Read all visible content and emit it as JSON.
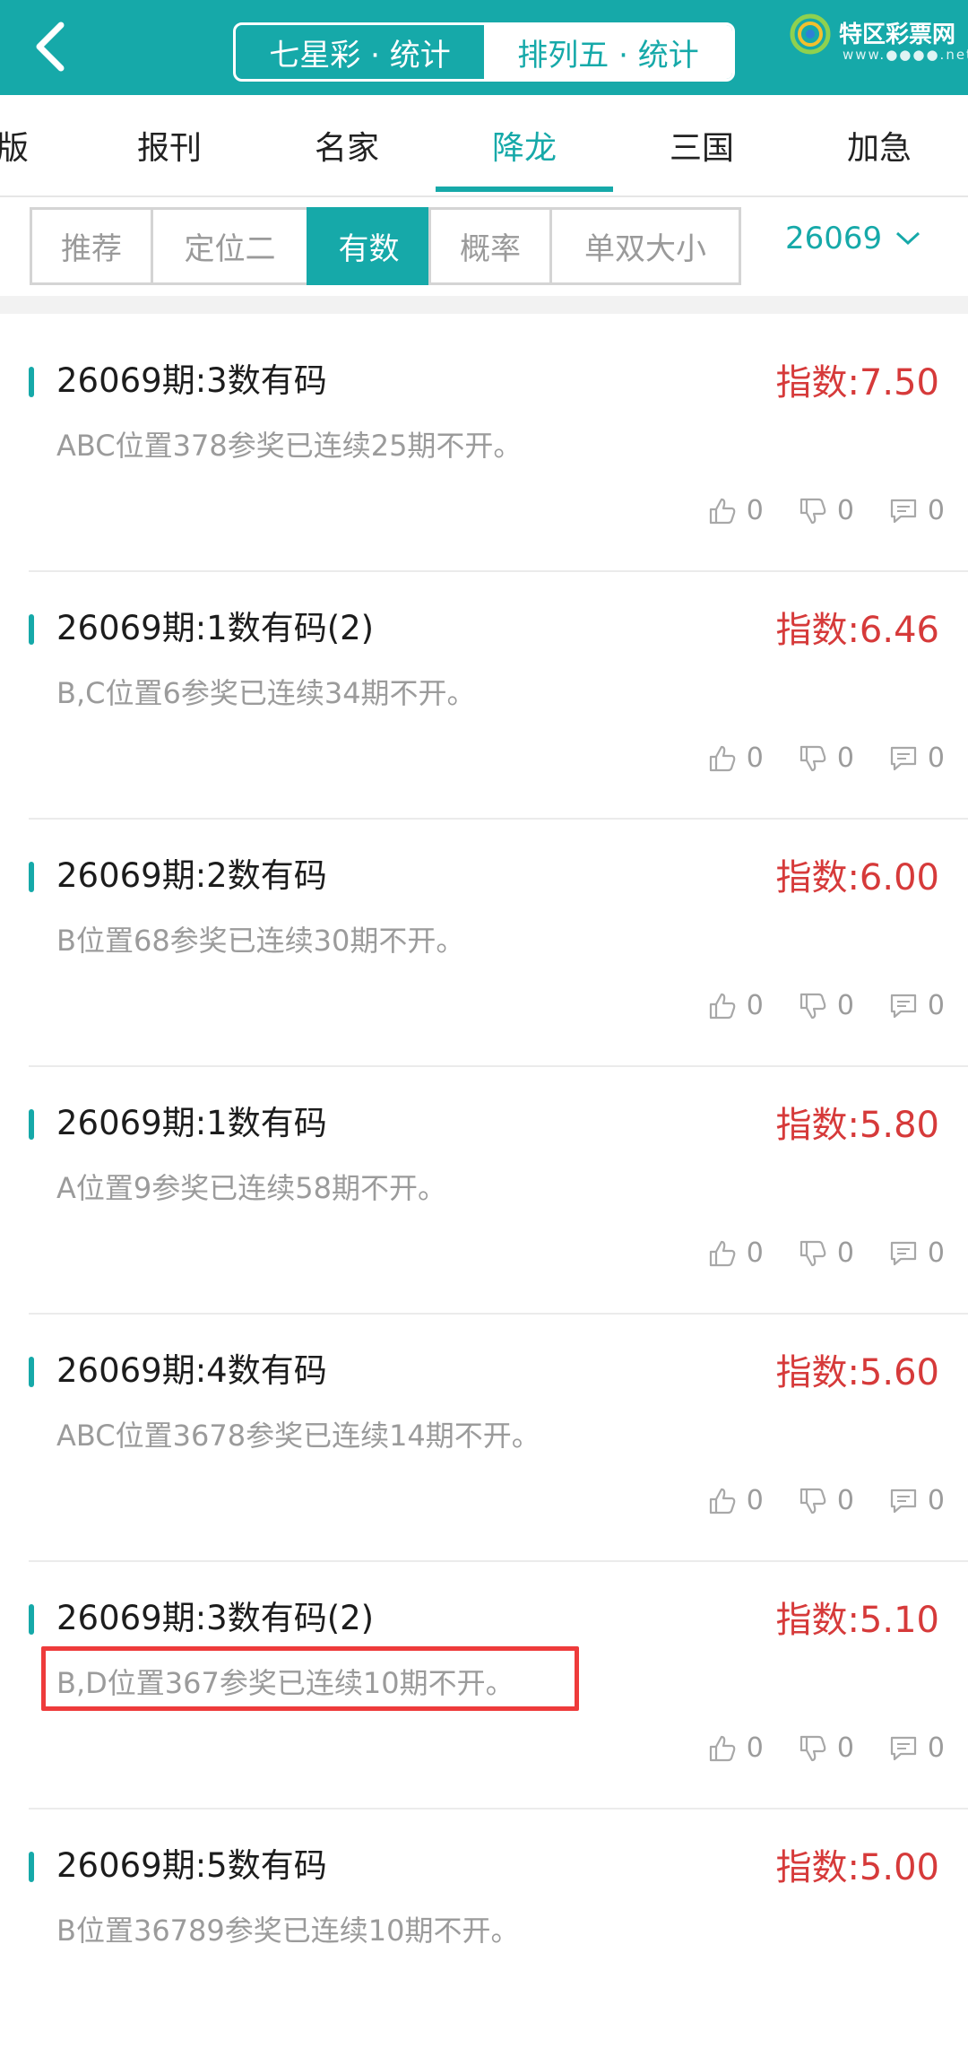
{
  "header": {
    "segments": [
      "七星彩 · 统计",
      "排列五 · 统计"
    ],
    "active_segment": 1,
    "brand_name": "特区彩票网",
    "brand_url": "www.●●●●.net",
    "colors": {
      "primary": "#16a9a9",
      "accent_red": "#d63a3a"
    }
  },
  "tabs": [
    "版",
    "报刊",
    "名家",
    "降龙",
    "三国",
    "加急"
  ],
  "active_tab": "降龙",
  "subtabs": [
    "推荐",
    "定位二",
    "有数",
    "概率",
    "单双大小"
  ],
  "active_subtab": "有数",
  "period_selector": {
    "value": "26069",
    "icon": "chevron-down-icon"
  },
  "items": [
    {
      "title": "26069期:3数有码",
      "index": "指数:7.50",
      "desc": "ABC位置378参奖已连续25期不开。",
      "likes": "0",
      "dislikes": "0",
      "comments": "0"
    },
    {
      "title": "26069期:1数有码(2)",
      "index": "指数:6.46",
      "desc": "B,C位置6参奖已连续34期不开。",
      "likes": "0",
      "dislikes": "0",
      "comments": "0"
    },
    {
      "title": "26069期:2数有码",
      "index": "指数:6.00",
      "desc": "B位置68参奖已连续30期不开。",
      "likes": "0",
      "dislikes": "0",
      "comments": "0"
    },
    {
      "title": "26069期:1数有码",
      "index": "指数:5.80",
      "desc": "A位置9参奖已连续58期不开。",
      "likes": "0",
      "dislikes": "0",
      "comments": "0"
    },
    {
      "title": "26069期:4数有码",
      "index": "指数:5.60",
      "desc": "ABC位置3678参奖已连续14期不开。",
      "likes": "0",
      "dislikes": "0",
      "comments": "0"
    },
    {
      "title": "26069期:3数有码(2)",
      "index": "指数:5.10",
      "desc": "B,D位置367参奖已连续10期不开。",
      "likes": "0",
      "dislikes": "0",
      "comments": "0"
    },
    {
      "title": "26069期:5数有码",
      "index": "指数:5.00",
      "desc": "B位置36789参奖已连续10期不开。",
      "likes": "0",
      "dislikes": "0",
      "comments": "0"
    }
  ],
  "icons": {
    "back": "back-arrow-icon",
    "like": "thumbs-up-icon",
    "dislike": "thumbs-down-icon",
    "comment": "comment-icon"
  }
}
